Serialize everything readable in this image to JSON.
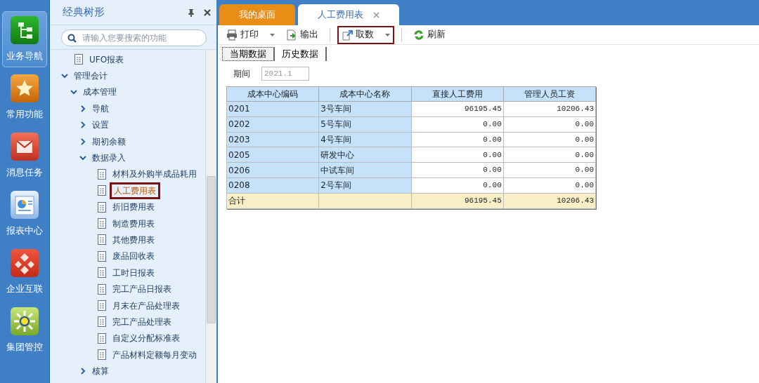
{
  "rail": [
    {
      "label": "业务导航",
      "kind": "navigation",
      "selected": true
    },
    {
      "label": "常用功能",
      "kind": "favorites",
      "selected": false
    },
    {
      "label": "消息任务",
      "kind": "messages",
      "selected": false
    },
    {
      "label": "报表中心",
      "kind": "reports",
      "selected": false
    },
    {
      "label": "企业互联",
      "kind": "connect",
      "selected": false
    },
    {
      "label": "集团管控",
      "kind": "group",
      "selected": false
    }
  ],
  "sidebar": {
    "title": "经典树形",
    "search": {
      "placeholder": "请输入您要搜索的功能"
    },
    "items": [
      {
        "label": "UFO报表",
        "kind": "leaf",
        "selected": false
      },
      {
        "label": "管理会计",
        "kind": "folder",
        "expanded": true,
        "children": [
          {
            "label": "成本管理",
            "kind": "folder",
            "expanded": true,
            "children": [
              {
                "label": "导航",
                "kind": "folder",
                "expanded": false
              },
              {
                "label": "设置",
                "kind": "folder",
                "expanded": false
              },
              {
                "label": "期初余额",
                "kind": "folder",
                "expanded": false
              },
              {
                "label": "数据录入",
                "kind": "folder",
                "expanded": true,
                "children": [
                  {
                    "label": "材料及外购半成品耗用",
                    "kind": "leaf",
                    "selected": false
                  },
                  {
                    "label": "人工费用表",
                    "kind": "leaf",
                    "selected": true
                  },
                  {
                    "label": "折旧费用表",
                    "kind": "leaf",
                    "selected": false
                  },
                  {
                    "label": "制造费用表",
                    "kind": "leaf",
                    "selected": false
                  },
                  {
                    "label": "其他费用表",
                    "kind": "leaf",
                    "selected": false
                  },
                  {
                    "label": "废品回收表",
                    "kind": "leaf",
                    "selected": false
                  },
                  {
                    "label": "工时日报表",
                    "kind": "leaf",
                    "selected": false
                  },
                  {
                    "label": "完工产品日报表",
                    "kind": "leaf",
                    "selected": false
                  },
                  {
                    "label": "月末在产品处理表",
                    "kind": "leaf",
                    "selected": false
                  },
                  {
                    "label": "完工产品处理表",
                    "kind": "leaf",
                    "selected": false
                  },
                  {
                    "label": "自定义分配标准表",
                    "kind": "leaf",
                    "selected": false
                  },
                  {
                    "label": "产品材料定额每月变动",
                    "kind": "leaf",
                    "selected": false
                  }
                ]
              },
              {
                "label": "核算",
                "kind": "folder",
                "expanded": false
              }
            ]
          }
        ]
      }
    ]
  },
  "tabs": [
    {
      "label": "我的桌面",
      "selected": false,
      "closable": false
    },
    {
      "label": "人工费用表",
      "selected": true,
      "closable": true
    }
  ],
  "toolbar": [
    {
      "label": "打印",
      "kind": "print",
      "dropdown": true,
      "highlighted": false
    },
    {
      "label": "输出",
      "kind": "export",
      "dropdown": false,
      "highlighted": false
    },
    {
      "label": "取数",
      "kind": "fetch",
      "dropdown": true,
      "highlighted": true
    },
    {
      "label": "刷新",
      "kind": "refresh",
      "dropdown": false,
      "highlighted": false
    }
  ],
  "subtabs": [
    {
      "label": "当期数据",
      "selected": true
    },
    {
      "label": "历史数据",
      "selected": false
    }
  ],
  "period": {
    "label": "期间",
    "value": "2021.1",
    "disabled": true
  },
  "table": {
    "columns": [
      "成本中心编码",
      "成本中心名称",
      "直接人工费用",
      "管理人员工资"
    ],
    "rows": [
      {
        "kind": "data",
        "cells": [
          "0201",
          "3号车间",
          "96195.45",
          "10206.43"
        ]
      },
      {
        "kind": "data",
        "cells": [
          "0202",
          "5号车间",
          "0.00",
          "0.00"
        ]
      },
      {
        "kind": "data",
        "cells": [
          "0203",
          "4号车间",
          "0.00",
          "0.00"
        ]
      },
      {
        "kind": "data",
        "cells": [
          "0205",
          "研发中心",
          "0.00",
          "0.00"
        ]
      },
      {
        "kind": "data",
        "cells": [
          "0206",
          "中试车间",
          "0.00",
          "0.00"
        ]
      },
      {
        "kind": "data",
        "cells": [
          "0208",
          "2号车间",
          "0.00",
          "0.00"
        ]
      },
      {
        "kind": "total",
        "cells": [
          "合计",
          "",
          "96195.45",
          "10206.43"
        ]
      }
    ]
  }
}
